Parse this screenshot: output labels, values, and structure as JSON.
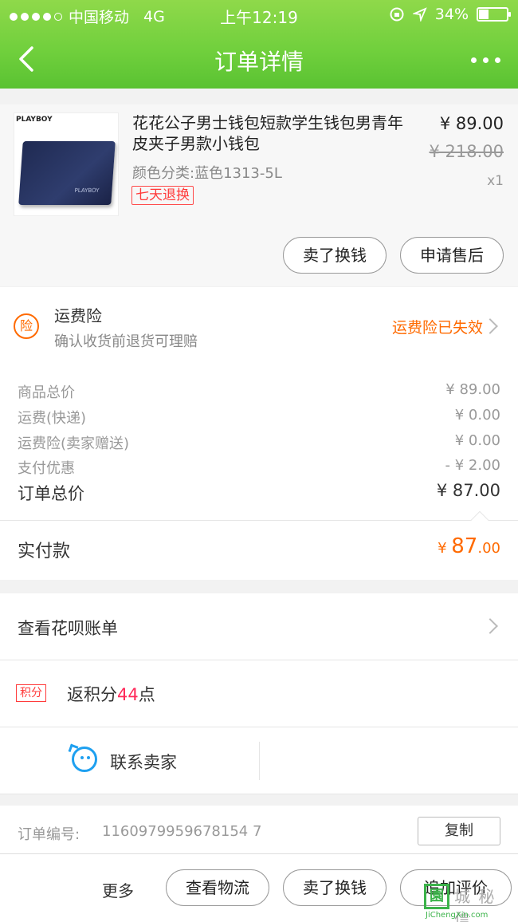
{
  "status_bar": {
    "carrier": "中国移动",
    "network": "4G",
    "time": "上午12:19",
    "battery": "34%",
    "battery_level": 0.34
  },
  "nav": {
    "title": "订单详情"
  },
  "product": {
    "brand_on_image": "PLAYBOY",
    "name": "花花公子男士钱包短款学生钱包男青年皮夹子男款小钱包",
    "sku": "颜色分类:蓝色1313-5L",
    "return_tag": "七天退换",
    "price": "¥ 89.00",
    "original_price": "¥ 218.00",
    "quantity": "x1",
    "buttons": {
      "sell": "卖了换钱",
      "after_sale": "申请售后"
    }
  },
  "insurance": {
    "icon_text": "险",
    "title": "运费险",
    "subtitle": "确认收货前退货可理赔",
    "status": "运费险已失效"
  },
  "price_breakdown": [
    {
      "label": "商品总价",
      "value": "¥ 89.00"
    },
    {
      "label": "运费(快递)",
      "value": "¥ 0.00"
    },
    {
      "label": "运费险(卖家赠送)",
      "value": "¥ 0.00"
    },
    {
      "label": "支付优惠",
      "value": "- ¥ 2.00"
    }
  ],
  "order_total": {
    "label": "订单总价",
    "value": "¥ 87.00"
  },
  "paid": {
    "label": "实付款",
    "currency": "¥",
    "integer": "87",
    "decimal": ".00"
  },
  "huabei": {
    "label": "查看花呗账单"
  },
  "points": {
    "tag": "积分",
    "prefix": "返积分",
    "count": "44",
    "suffix": "点"
  },
  "contact": {
    "label": "联系卖家"
  },
  "order_info": {
    "number_label": "订单编号:",
    "number": "1160979959678154 7",
    "copy_label": "复制"
  },
  "bottom_bar": {
    "more": "更多",
    "logistics": "查看物流",
    "sell": "卖了换钱",
    "review": "追加评价"
  },
  "watermark": {
    "cn": "城 秘 信",
    "en": "JiChengXin.com"
  }
}
